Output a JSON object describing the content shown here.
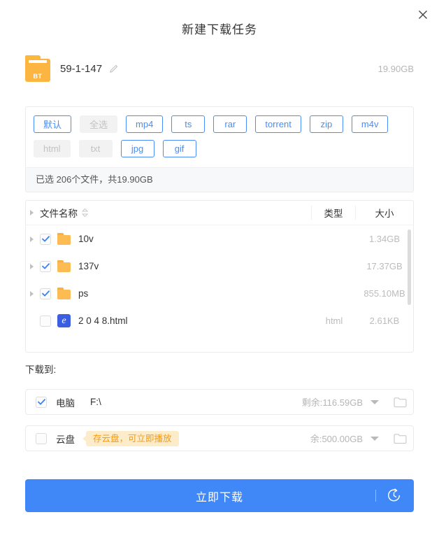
{
  "window": {
    "title": "新建下载任务",
    "close_label": "×"
  },
  "torrent": {
    "icon_label": "BT",
    "name": "59-1-147",
    "size": "19.90GB",
    "edit_icon": "pencil-icon"
  },
  "filters": {
    "tags": [
      {
        "label": "默认",
        "state": "on"
      },
      {
        "label": "全选",
        "state": "off"
      },
      {
        "label": "mp4",
        "state": "on"
      },
      {
        "label": "ts",
        "state": "on"
      },
      {
        "label": "rar",
        "state": "on"
      },
      {
        "label": "torrent",
        "state": "on"
      },
      {
        "label": "zip",
        "state": "on"
      },
      {
        "label": "m4v",
        "state": "on"
      },
      {
        "label": "html",
        "state": "off"
      },
      {
        "label": "txt",
        "state": "off"
      },
      {
        "label": "jpg",
        "state": "on"
      },
      {
        "label": "gif",
        "state": "on"
      }
    ],
    "summary": "已选 206个文件，共19.90GB"
  },
  "filelist": {
    "columns": {
      "name": "文件名称",
      "type": "类型",
      "size": "大小"
    },
    "rows": [
      {
        "name": "10v",
        "type": "",
        "size": "1.34GB",
        "checked": true,
        "icon": "folder-icon",
        "expandable": true
      },
      {
        "name": "137v",
        "type": "",
        "size": "17.37GB",
        "checked": true,
        "icon": "folder-icon",
        "expandable": true
      },
      {
        "name": "ps",
        "type": "",
        "size": "855.10MB",
        "checked": true,
        "icon": "folder-icon",
        "expandable": true
      },
      {
        "name": "2 0 4 8.html",
        "type": "html",
        "size": "2.61KB",
        "checked": false,
        "icon": "ie-browser-icon",
        "expandable": false
      }
    ]
  },
  "destination": {
    "label": "下载到:",
    "options": [
      {
        "name": "电脑",
        "path": "F:\\",
        "free": "剩余:116.59GB",
        "checked": true,
        "tip": ""
      },
      {
        "name": "云盘",
        "path": "",
        "free": "余:500.00GB",
        "checked": false,
        "tip": "存云盘，可立即播放"
      }
    ]
  },
  "action": {
    "download_label": "立即下载",
    "schedule_icon": "clock-timer-icon"
  },
  "colors": {
    "accent_blue": "#4087f7",
    "tag_blue": "#4a8cf7",
    "folder_orange": "#fcbc53",
    "tip_bg": "#fdecca",
    "tip_text": "#f79a13",
    "muted": "#b6b6b6"
  }
}
